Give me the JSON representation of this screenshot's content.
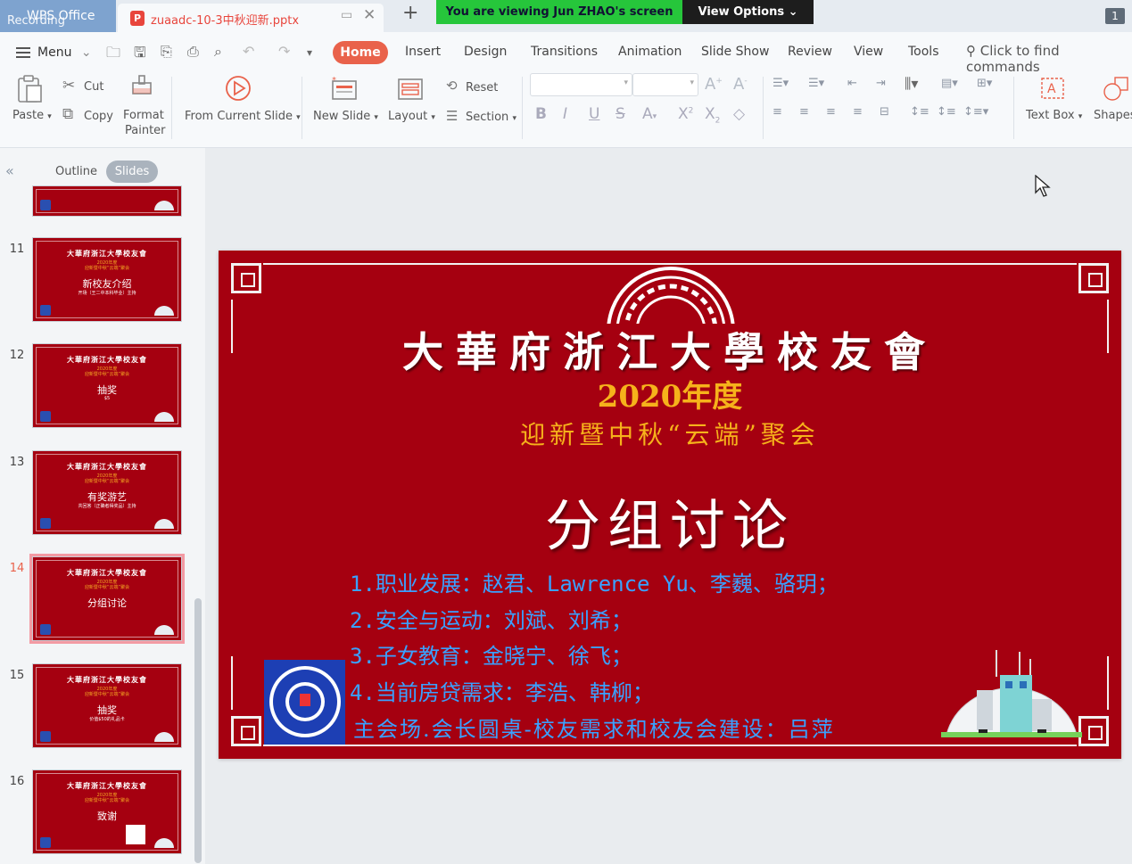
{
  "titlebar": {
    "app_name": "WPS Office",
    "recording": "Recording",
    "doc_name": "zuaadc-10-3中秋迎新.pptx",
    "doc_icon": "P",
    "share_banner": "You are viewing Jun ZHAO's screen",
    "view_options": "View Options",
    "badge": "1"
  },
  "menubar": {
    "menu": "Menu",
    "tabs": [
      "Home",
      "Insert",
      "Design",
      "Transitions",
      "Animation",
      "Slide Show",
      "Review",
      "View",
      "Tools"
    ],
    "find": "Click to find commands"
  },
  "ribbon": {
    "paste": "Paste",
    "cut": "Cut",
    "copy": "Copy",
    "format_painter_1": "Format",
    "format_painter_2": "Painter",
    "from_current_slide": "From Current Slide",
    "new_slide": "New Slide",
    "layout": "Layout",
    "reset": "Reset",
    "section": "Section",
    "text_box": "Text Box",
    "shapes": "Shapes"
  },
  "panel": {
    "outline": "Outline",
    "slides": "Slides"
  },
  "thumbnails": [
    {
      "num": "11",
      "title": "新校友介绍",
      "sub": "开场（王二中本科毕业）主持"
    },
    {
      "num": "12",
      "title": "抽奖",
      "sub": "$5"
    },
    {
      "num": "13",
      "title": "有奖游艺",
      "sub": "共回答（正确者得奖品）主持"
    },
    {
      "num": "14",
      "title": "分组讨论",
      "sub": ""
    },
    {
      "num": "15",
      "title": "抽奖",
      "sub": "价值$50的礼品卡"
    },
    {
      "num": "16",
      "title": "致谢",
      "sub": ""
    }
  ],
  "thumb_common": {
    "t1": "大華府浙江大學校友會",
    "t2": "2020年度",
    "t3": "迎新暨中秋“云端”聚会"
  },
  "slide": {
    "title": "大華府浙江大學校友會",
    "year": "2020年度",
    "event": "迎新暨中秋“云端”聚会",
    "topic": "分组讨论",
    "items": [
      "1.职业发展：赵君、Lawrence Yu、李巍、骆玥；",
      "2.安全与运动：刘斌、刘希；",
      "3.子女教育：金晓宁、徐飞；",
      "4.当前房贷需求：李浩、韩柳；",
      "主会场.会长圆桌-校友需求和校友会建设：吕萍"
    ]
  },
  "colors": {
    "slide_bg": "#a50010",
    "accent_gold": "#f6b21b",
    "item_blue": "#3aa1ff",
    "home_tab": "#e9624b",
    "banner_green": "#26c63b"
  }
}
